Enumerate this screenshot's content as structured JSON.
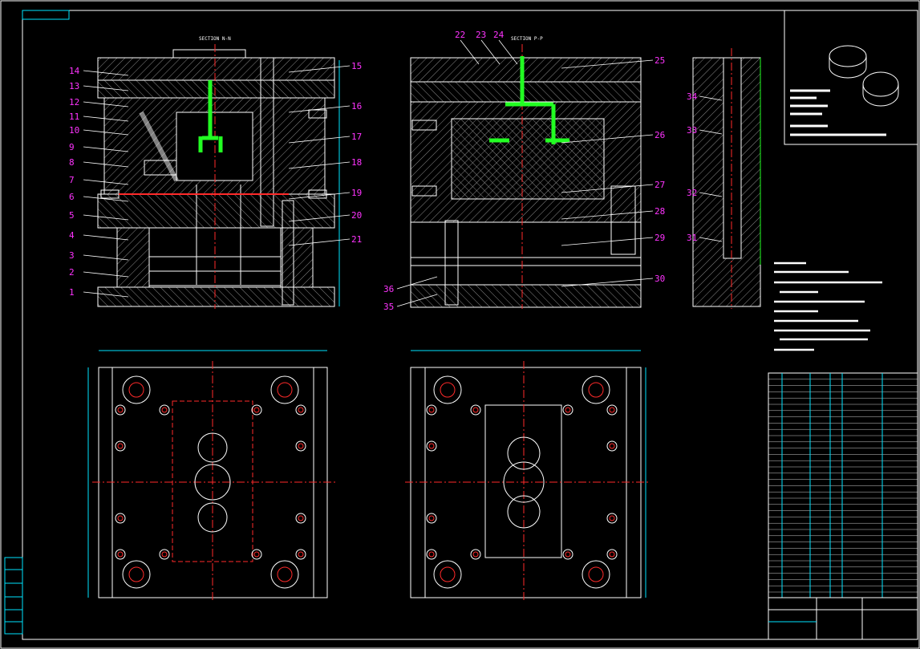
{
  "sections": {
    "nn": "SECTION N-N",
    "pp": "SECTION P-P"
  },
  "left_labels": [
    "14",
    "13",
    "12",
    "11",
    "10",
    "9",
    "8",
    "7",
    "6",
    "5",
    "4",
    "3",
    "2",
    "1"
  ],
  "left_labels_right": [
    "15",
    "16",
    "17",
    "18",
    "19",
    "20",
    "21"
  ],
  "mid_labels_top": [
    "22",
    "23",
    "24"
  ],
  "mid_labels_right": [
    "25",
    "26",
    "27",
    "28",
    "29",
    "30"
  ],
  "mid_labels_left": [
    "36",
    "35"
  ],
  "side_labels": [
    "34",
    "33",
    "32",
    "31"
  ],
  "colors": {
    "label": "#ff33ff",
    "outline": "#ffffff",
    "hatch": "#8a8a8a",
    "center": "#ff2a2a",
    "runner": "#22ff22",
    "cyan": "#00e5ff",
    "yellow": "#ffff33"
  }
}
